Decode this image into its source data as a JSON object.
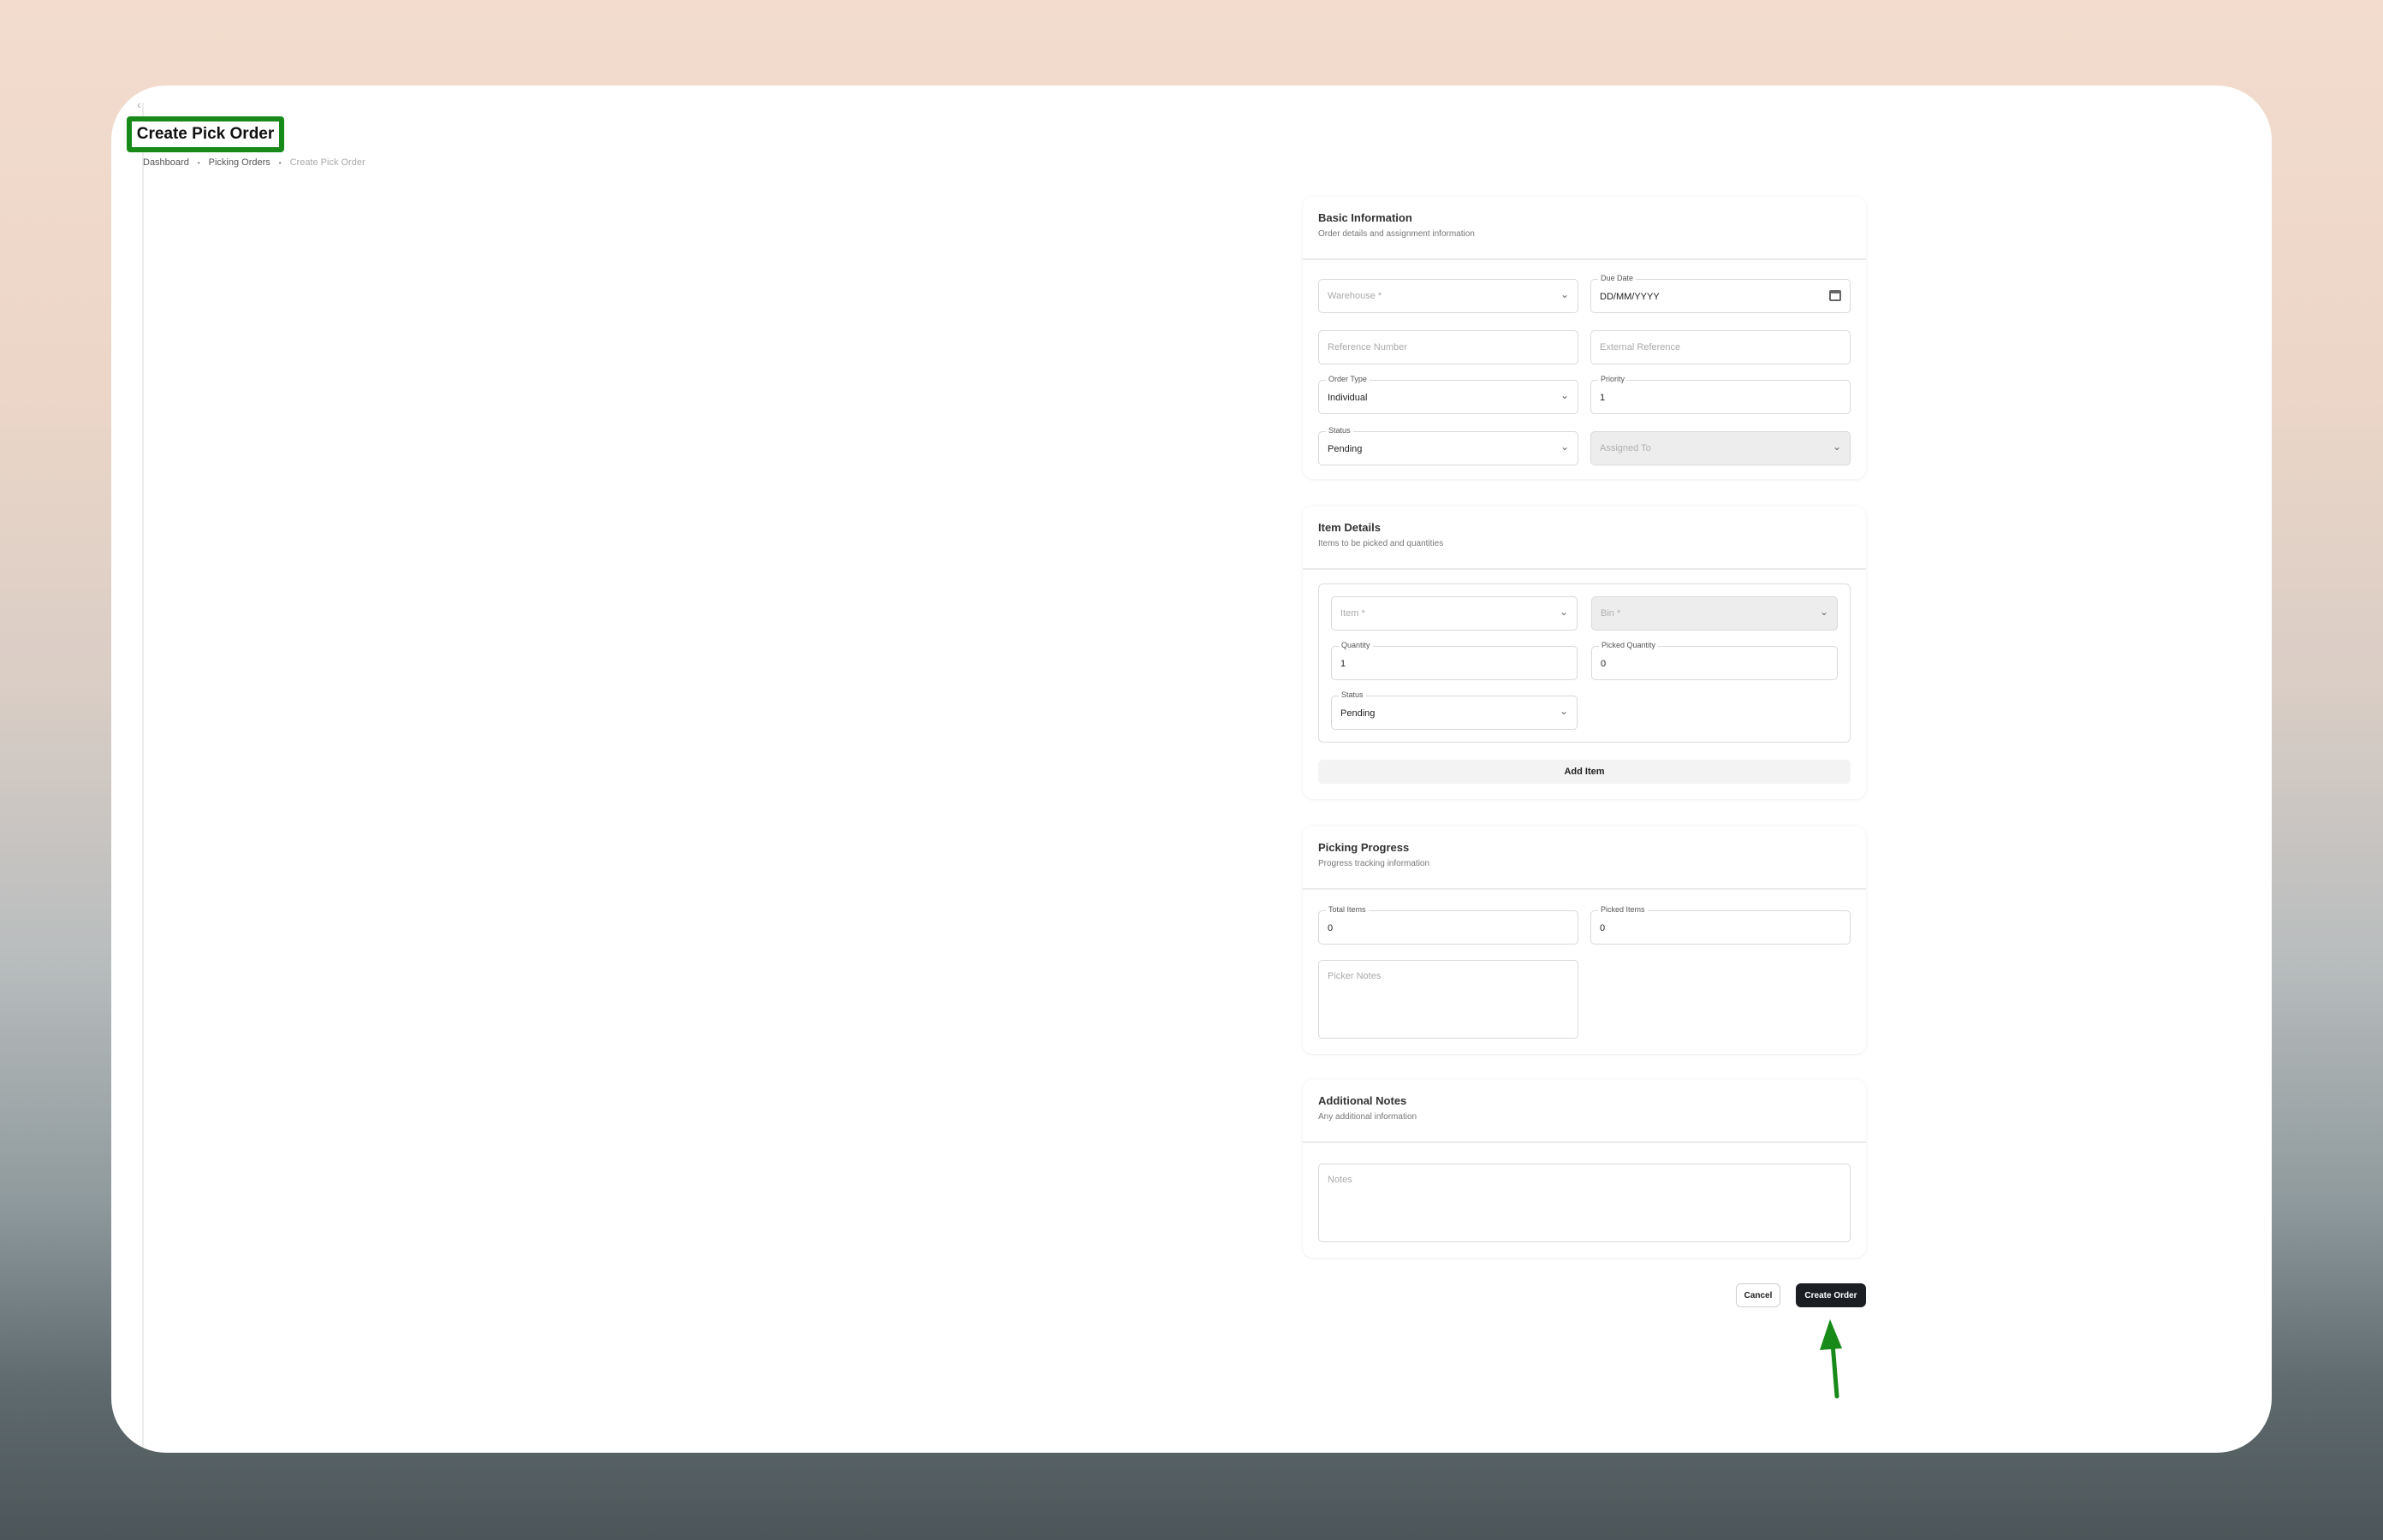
{
  "page": {
    "title": "Create Pick Order",
    "breadcrumb": [
      "Dashboard",
      "Picking Orders",
      "Create Pick Order"
    ],
    "annotation_color": "#178a1a"
  },
  "basic": {
    "title": "Basic Information",
    "subtitle": "Order details and assignment information",
    "warehouse_placeholder": "Warehouse *",
    "due_date_label": "Due Date",
    "due_date_value": "DD/MM/YYYY",
    "reference_placeholder": "Reference Number",
    "external_placeholder": "External Reference",
    "order_type_label": "Order Type",
    "order_type_value": "Individual",
    "priority_label": "Priority",
    "priority_value": "1",
    "status_label": "Status",
    "status_value": "Pending",
    "assigned_placeholder": "Assigned To"
  },
  "items": {
    "title": "Item Details",
    "subtitle": "Items to be picked and quantities",
    "item_placeholder": "Item *",
    "bin_placeholder": "Bin *",
    "quantity_label": "Quantity",
    "quantity_value": "1",
    "picked_qty_label": "Picked Quantity",
    "picked_qty_value": "0",
    "status_label": "Status",
    "status_value": "Pending",
    "add_label": "Add Item"
  },
  "progress": {
    "title": "Picking Progress",
    "subtitle": "Progress tracking information",
    "total_label": "Total Items",
    "total_value": "0",
    "picked_label": "Picked Items",
    "picked_value": "0",
    "notes_placeholder": "Picker Notes"
  },
  "notes": {
    "title": "Additional Notes",
    "subtitle": "Any additional information",
    "notes_placeholder": "Notes"
  },
  "actions": {
    "cancel_label": "Cancel",
    "create_label": "Create Order"
  }
}
